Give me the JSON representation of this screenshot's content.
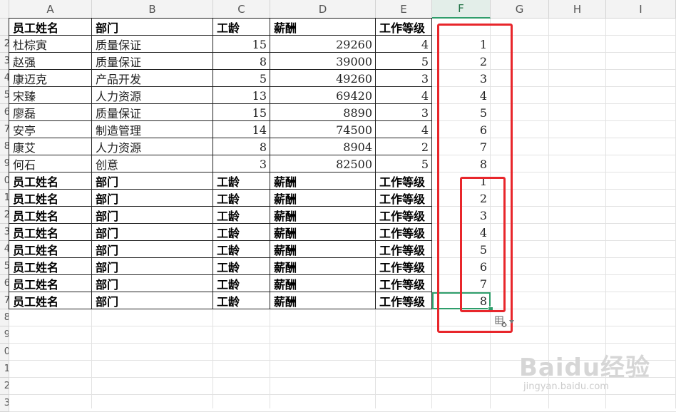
{
  "columns": [
    "A",
    "B",
    "C",
    "D",
    "E",
    "F",
    "G",
    "H",
    "I"
  ],
  "active_column": "F",
  "row_numbers": [
    "",
    "2",
    "3",
    "4",
    "5",
    "6",
    "7",
    "8",
    "9",
    "0",
    "1",
    "2",
    "3",
    "4",
    "5",
    "6",
    "7",
    "8",
    "9",
    "0",
    "1",
    "2",
    "3"
  ],
  "header_row": {
    "name": "员工姓名",
    "dept": "部门",
    "years": "工龄",
    "salary": "薪酬",
    "level": "工作等级"
  },
  "rows": [
    {
      "name": "杜棕寅",
      "dept": "质量保证",
      "years": "15",
      "salary": "29260",
      "level": "4",
      "f": "1"
    },
    {
      "name": "赵强",
      "dept": "质量保证",
      "years": "8",
      "salary": "39000",
      "level": "5",
      "f": "2"
    },
    {
      "name": "康迈克",
      "dept": "产品开发",
      "years": "5",
      "salary": "49260",
      "level": "3",
      "f": "3"
    },
    {
      "name": "宋臻",
      "dept": "人力资源",
      "years": "13",
      "salary": "69420",
      "level": "4",
      "f": "4"
    },
    {
      "name": "廖磊",
      "dept": "质量保证",
      "years": "15",
      "salary": "8890",
      "level": "3",
      "f": "5"
    },
    {
      "name": "安亭",
      "dept": "制造管理",
      "years": "14",
      "salary": "74500",
      "level": "4",
      "f": "6"
    },
    {
      "name": "康艾",
      "dept": "人力资源",
      "years": "8",
      "salary": "8904",
      "level": "2",
      "f": "7"
    },
    {
      "name": "何石",
      "dept": "创意",
      "years": "3",
      "salary": "82500",
      "level": "5",
      "f": "8"
    }
  ],
  "repeated_header_rows": [
    {
      "name": "员工姓名",
      "dept": "部门",
      "years": "工龄",
      "salary": "薪酬",
      "level": "工作等级",
      "f": "1"
    },
    {
      "name": "员工姓名",
      "dept": "部门",
      "years": "工龄",
      "salary": "薪酬",
      "level": "工作等级",
      "f": "2"
    },
    {
      "name": "员工姓名",
      "dept": "部门",
      "years": "工龄",
      "salary": "薪酬",
      "level": "工作等级",
      "f": "3"
    },
    {
      "name": "员工姓名",
      "dept": "部门",
      "years": "工龄",
      "salary": "薪酬",
      "level": "工作等级",
      "f": "4"
    },
    {
      "name": "员工姓名",
      "dept": "部门",
      "years": "工龄",
      "salary": "薪酬",
      "level": "工作等级",
      "f": "5"
    },
    {
      "name": "员工姓名",
      "dept": "部门",
      "years": "工龄",
      "salary": "薪酬",
      "level": "工作等级",
      "f": "6"
    },
    {
      "name": "员工姓名",
      "dept": "部门",
      "years": "工龄",
      "salary": "薪酬",
      "level": "工作等级",
      "f": "7"
    },
    {
      "name": "员工姓名",
      "dept": "部门",
      "years": "工龄",
      "salary": "薪酬",
      "level": "工作等级",
      "f": "8"
    }
  ],
  "annotation_color": "#e8262b",
  "selection_color": "#2f9e6b",
  "icons": {
    "fill_options": "auto-fill-options-icon",
    "dropdown": "chevron-down-icon"
  },
  "watermark": {
    "logo": "Baidu经验",
    "url": "jingyan.baidu.com"
  }
}
